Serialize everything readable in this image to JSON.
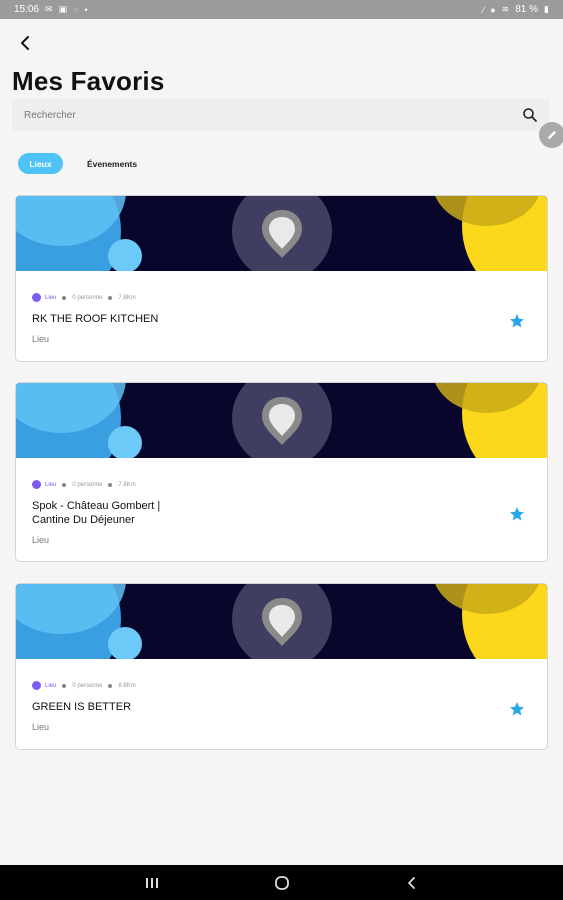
{
  "status_bar": {
    "time": "15:06",
    "battery": "81 %"
  },
  "page": {
    "title": "Mes Favoris"
  },
  "search": {
    "placeholder": "Rechercher"
  },
  "tabs": [
    {
      "label": "Lieux",
      "active": true
    },
    {
      "label": "Évenements",
      "active": false
    }
  ],
  "favorites": [
    {
      "category": "Lieu",
      "people": "0 personne",
      "distance": "7.8Km",
      "name": "RK THE ROOF KITCHEN",
      "type": "Lieu",
      "starred": true
    },
    {
      "category": "Lieu",
      "people": "0 personne",
      "distance": "7.8Km",
      "name": "Spok - Château Gombert | Cantine Du Déjeuner",
      "type": "Lieu",
      "starred": true
    },
    {
      "category": "Lieu",
      "people": "0 personne",
      "distance": "8.8Km",
      "name": "GREEN IS BETTER",
      "type": "Lieu",
      "starred": true
    }
  ],
  "colors": {
    "accent": "#4fc3f7",
    "star": "#29a8e8",
    "category": "#7c5cf0",
    "banner_bg": "#08062a",
    "banner_yellow": "#fcd81c"
  },
  "icons": {
    "back": "arrow-left-icon",
    "search": "search-icon",
    "edit": "pencil-icon",
    "pin": "location-pin-icon",
    "star": "star-icon"
  }
}
